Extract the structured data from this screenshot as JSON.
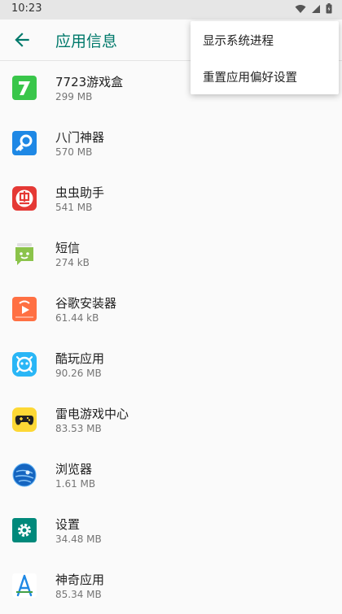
{
  "statusbar": {
    "time": "10:23",
    "icons": [
      "wifi-icon",
      "signal-icon",
      "battery-icon"
    ]
  },
  "appbar": {
    "back_icon": "back-arrow-icon",
    "title": "应用信息"
  },
  "menu": {
    "items": [
      {
        "label": "显示系统进程"
      },
      {
        "label": "重置应用偏好设置"
      }
    ]
  },
  "apps": [
    {
      "name": "7723游戏盒",
      "size": "299 MB",
      "icon": "game-box-icon"
    },
    {
      "name": "八门神器",
      "size": "570 MB",
      "icon": "key-tool-icon"
    },
    {
      "name": "虫虫助手",
      "size": "541 MB",
      "icon": "bug-helper-icon"
    },
    {
      "name": "短信",
      "size": "274 kB",
      "icon": "messaging-icon"
    },
    {
      "name": "谷歌安装器",
      "size": "61.44 kB",
      "icon": "google-installer-icon"
    },
    {
      "name": "酷玩应用",
      "size": "90.26 MB",
      "icon": "kuwan-app-icon"
    },
    {
      "name": "雷电游戏中心",
      "size": "83.53 MB",
      "icon": "gamepad-icon"
    },
    {
      "name": "浏览器",
      "size": "1.61 MB",
      "icon": "browser-icon"
    },
    {
      "name": "设置",
      "size": "34.48 MB",
      "icon": "settings-gear-icon"
    },
    {
      "name": "神奇应用",
      "size": "85.34 MB",
      "icon": "magic-app-icon"
    }
  ],
  "colors": {
    "accent": "#00796b",
    "statusbar": "#e6e6e6",
    "background": "#fafafa"
  }
}
